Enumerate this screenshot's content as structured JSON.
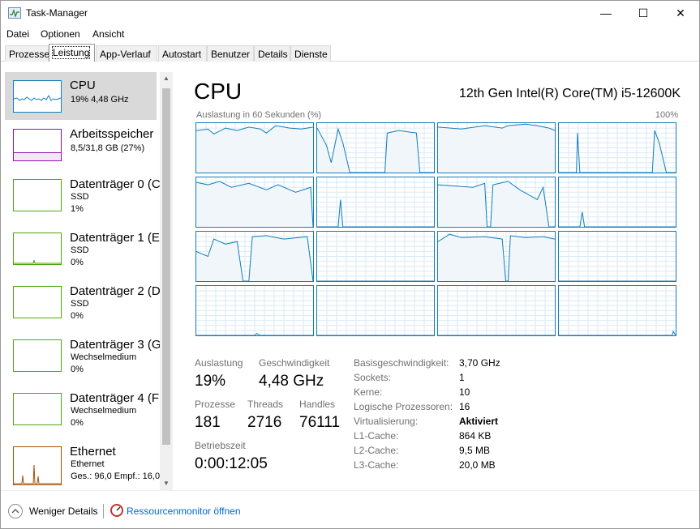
{
  "window": {
    "title": "Task-Manager",
    "controls": [
      "—",
      "☐",
      "✕"
    ]
  },
  "menu": {
    "items": [
      {
        "label": "Datei"
      },
      {
        "label": "Optionen"
      },
      {
        "label": "Ansicht"
      }
    ]
  },
  "tabs": [
    {
      "label": "Prozesse"
    },
    {
      "label": "Leistung",
      "active": true
    },
    {
      "label": "App-Verlauf"
    },
    {
      "label": "Autostart"
    },
    {
      "label": "Benutzer"
    },
    {
      "label": "Details"
    },
    {
      "label": "Dienste"
    }
  ],
  "sidebar": {
    "items": [
      {
        "name": "CPU",
        "lines": [
          "19% 4,48 GHz"
        ],
        "color": "#117dbb",
        "selected": true
      },
      {
        "name": "Arbeitsspeicher",
        "lines": [
          "8,5/31,8 GB (27%)"
        ],
        "color": "#8b12ae"
      },
      {
        "name": "Datenträger 0 (C",
        "lines": [
          "SSD",
          "1%"
        ],
        "color": "#4da60c"
      },
      {
        "name": "Datenträger 1 (E",
        "lines": [
          "SSD",
          "0%"
        ],
        "color": "#4da60c"
      },
      {
        "name": "Datenträger 2 (D",
        "lines": [
          "SSD",
          "0%"
        ],
        "color": "#4da60c"
      },
      {
        "name": "Datenträger 3 (G",
        "lines": [
          "Wechselmedium",
          "0%"
        ],
        "color": "#4da60c"
      },
      {
        "name": "Datenträger 4 (F",
        "lines": [
          "Wechselmedium",
          "0%"
        ],
        "color": "#4da60c"
      },
      {
        "name": "Ethernet",
        "lines": [
          "Ethernet",
          "Ges.: 96,0  Empf.: 16,0"
        ],
        "color": "#a74f01"
      }
    ]
  },
  "main": {
    "title": "CPU",
    "model": "12th Gen Intel(R) Core(TM) i5-12600K",
    "graph_label": "Auslastung in 60 Sekunden (%)",
    "graph_max": "100%",
    "stats": {
      "auslastung_label": "Auslastung",
      "auslastung_value": "19%",
      "geschwindigkeit_label": "Geschwindigkeit",
      "geschwindigkeit_value": "4,48 GHz",
      "prozesse_label": "Prozesse",
      "prozesse_value": "181",
      "threads_label": "Threads",
      "threads_value": "2716",
      "handles_label": "Handles",
      "handles_value": "76111",
      "betriebszeit_label": "Betriebszeit",
      "betriebszeit_value": "0:00:12:05"
    },
    "info": [
      {
        "label": "Basisgeschwindigkeit:",
        "value": "3,70 GHz",
        "bold": false
      },
      {
        "label": "Sockets:",
        "value": "1",
        "bold": false
      },
      {
        "label": "Kerne:",
        "value": "10",
        "bold": false
      },
      {
        "label": "Logische Prozessoren:",
        "value": "16",
        "bold": false
      },
      {
        "label": "Virtualisierung:",
        "value": "Aktiviert",
        "bold": true
      },
      {
        "label": "L1-Cache:",
        "value": "864 KB",
        "bold": false
      },
      {
        "label": "L2-Cache:",
        "value": "9,5 MB",
        "bold": false
      },
      {
        "label": "L3-Cache:",
        "value": "20,0 MB",
        "bold": false
      }
    ]
  },
  "footer": {
    "less_details": "Weniger Details",
    "resource_monitor": "Ressourcenmonitor öffnen"
  },
  "colors": {
    "cpu_line": "#117dbb",
    "cpu_fill": "#f1f6fa",
    "grid": "#d9eaf4",
    "link": "#0066cc"
  }
}
